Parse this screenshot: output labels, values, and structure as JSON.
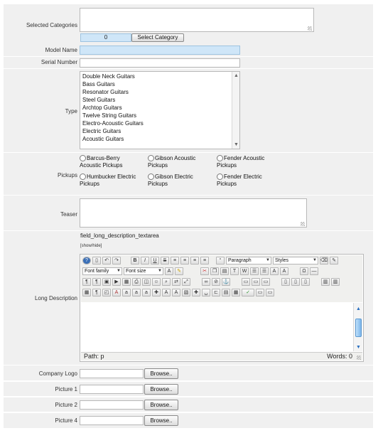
{
  "labels": {
    "selected_categories": "Selected Categories",
    "model_name": "Model Name",
    "serial_number": "Serial Number",
    "type": "Type",
    "pickups": "Pickups",
    "teaser": "Teaser",
    "long_description": "Long Description",
    "company_logo": "Company Logo",
    "picture_1": "Picture 1",
    "picture_2": "Picture 2",
    "picture_4": "Picture 4"
  },
  "categories": {
    "count": "0",
    "select_button": "Select Category"
  },
  "type_options": [
    "Double Neck Guitars",
    "Bass Guitars",
    "Resonator Guitars",
    "Steel Guitars",
    "Archtop Guitars",
    "Twelve String Guitars",
    "Electro-Acoustic Guitars",
    "Electric Guitars",
    "Acoustic Guitars"
  ],
  "pickups": [
    {
      "line1": "Barcus-Berry",
      "line2": "Acoustic Pickups"
    },
    {
      "line1": "Gibson Acoustic",
      "line2": "Pickups"
    },
    {
      "line1": "Fender Acoustic",
      "line2": "Pickups"
    },
    {
      "line1": "Humbucker Electric",
      "line2": "Pickups"
    },
    {
      "line1": "Gibson Electric",
      "line2": "Pickups"
    },
    {
      "line1": "Fender Electric",
      "line2": "Pickups"
    }
  ],
  "editor": {
    "field_name": "field_long_description_textarea",
    "show_hide": "[show/hide]",
    "format_select": "Paragraph",
    "styles_select": "Styles",
    "font_family_select": "Font family",
    "font_size_select": "Font size",
    "path": "Path: p",
    "words": "Words: 0"
  },
  "browse_label": "Browse..",
  "colors": {
    "row_bg": "#f0f0f0",
    "accent_input": "#cfe6f8"
  }
}
